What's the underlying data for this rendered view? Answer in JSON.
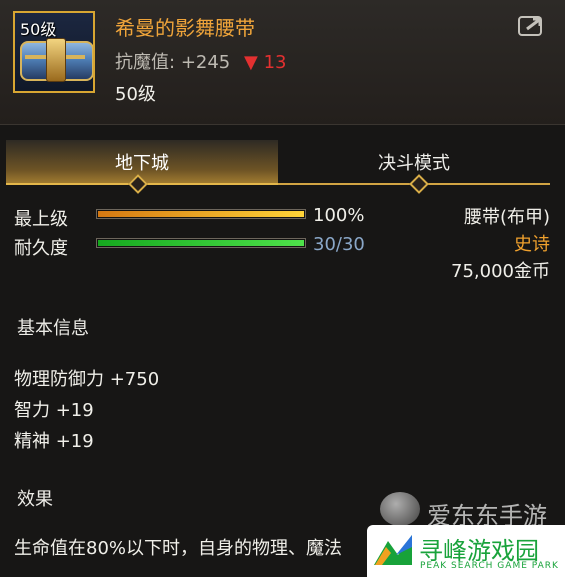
{
  "item": {
    "level_badge": "50级",
    "name": "希曼的影舞腰带",
    "magic_resist_label": "抗魔值:",
    "magic_resist_value": "+245",
    "magic_resist_change": "13",
    "required_level": "50级"
  },
  "tabs": [
    "地下城",
    "决斗模式"
  ],
  "stats": {
    "max_level_label": "最上级",
    "max_level_value": "100%",
    "max_level_fraction": 1.0,
    "durability_label": "耐久度",
    "durability_value": "30/30",
    "durability_fraction": 1.0
  },
  "item_info": {
    "slot": "腰带(布甲)",
    "rarity": "史诗",
    "price": "75,000金币"
  },
  "basic_info": {
    "title": "基本信息",
    "attributes": [
      "物理防御力 +750",
      "智力 +19",
      "精神 +19"
    ]
  },
  "effect": {
    "title": "效果",
    "text": "生命值在80%以下时，自身的物理、魔法"
  },
  "watermarks": {
    "left": "爱东东手游",
    "right": "寻峰游戏园",
    "right_sub": "PEAK SEARCH GAME PARK"
  },
  "colors": {
    "epic": "#f0a12d",
    "name": "#efa43a",
    "decrease": "#e33030",
    "tab_gold": "#e4b74a"
  },
  "icons": [
    "belt-item-icon",
    "share-icon",
    "down-arrow-icon",
    "tab-marker-icon"
  ]
}
